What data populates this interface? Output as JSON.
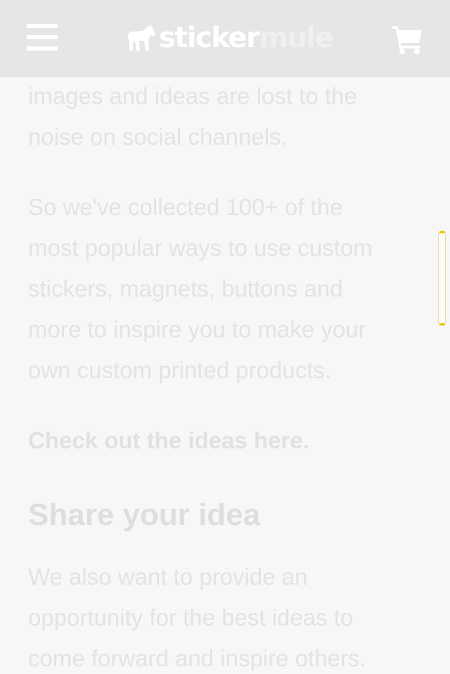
{
  "header": {
    "logo_part1": "sticker",
    "logo_part2": "mule",
    "menu_icon": "hamburger-menu-icon",
    "cart_icon": "shopping-cart-icon",
    "background": "#e6e6e6"
  },
  "content": {
    "para1_lines": [
      "images and ideas are lost to the",
      "noise on social channels."
    ],
    "para2_lines": [
      "So we've collected 100+ of the",
      "most popular ways to use custom",
      "stickers, magnets, buttons and",
      "more to inspire you to make your",
      "own custom printed products."
    ],
    "link_text": "Check out the ideas here.",
    "heading": "Share your idea",
    "para3_lines": [
      "We also want to provide an",
      "opportunity for the best ideas to",
      "come forward and inspire others."
    ]
  }
}
